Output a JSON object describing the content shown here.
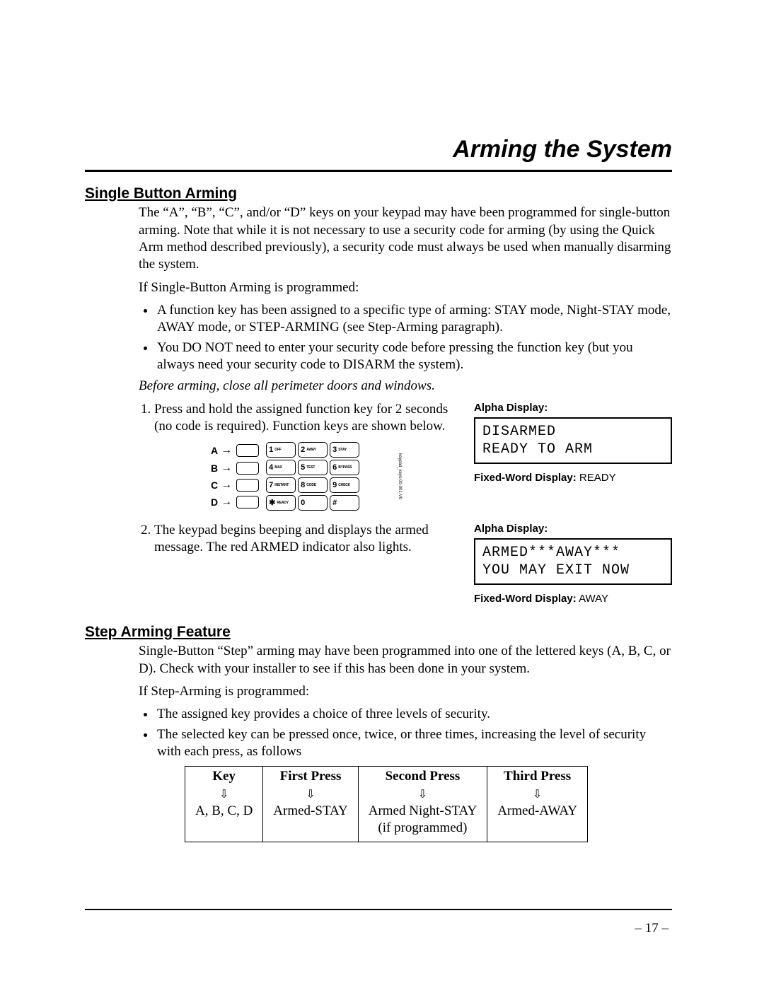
{
  "title": "Arming the System",
  "page_number": "– 17 –",
  "sections": {
    "single_button": {
      "heading": "Single Button Arming",
      "p1": "The “A”, “B”, “C”, and/or “D” keys on your keypad may have been programmed for single-button arming. Note that while it is not necessary to use a security code for arming (by using the Quick Arm method described previously), a security code must always be used when manually disarming the system.",
      "p2": "If Single-Button Arming is programmed:",
      "bullets": [
        "A function key has been assigned to a specific type of arming: STAY mode, Night-STAY mode, AWAY mode, or STEP-ARMING (see Step-Arming paragraph).",
        "You DO NOT need to enter your security code before pressing the function key (but you always need your security code to DISARM the system)."
      ],
      "preface": "Before arming, close all perimeter doors and windows.",
      "step1": "Press and hold the assigned function key for 2 seconds (no code is required). Function keys are shown below.",
      "step2": "The keypad begins beeping and displays the armed message. The red ARMED indicator also lights."
    },
    "step_arming": {
      "heading": "Step Arming Feature",
      "p1": "Single-Button “Step” arming may have been programmed into one of the lettered keys (A, B, C, or D). Check with your installer to see if this has been done in your system.",
      "p2": "If Step-Arming is programmed:",
      "bullets": [
        "The assigned key provides a choice of three levels of security.",
        "The selected key can be pressed once, twice, or three times, increasing the level of security with each press, as follows"
      ]
    }
  },
  "displays": {
    "alpha_label": "Alpha Display:",
    "fixed_label": "Fixed-Word Display:",
    "d1_line1": "DISARMED",
    "d1_line2": "READY TO ARM",
    "d1_fixed": "READY",
    "d2_line1": "ARMED***AWAY***",
    "d2_line2": "YOU MAY EXIT NOW",
    "d2_fixed": "AWAY"
  },
  "keypad": {
    "rows": [
      "A",
      "B",
      "C",
      "D"
    ],
    "keys": [
      {
        "d": "1",
        "s": "OFF"
      },
      {
        "d": "2",
        "s": "AWAY"
      },
      {
        "d": "3",
        "s": "STAY"
      },
      {
        "d": "4",
        "s": "MAX"
      },
      {
        "d": "5",
        "s": "TEST"
      },
      {
        "d": "6",
        "s": "BYPASS"
      },
      {
        "d": "7",
        "s": "INSTANT"
      },
      {
        "d": "8",
        "s": "CODE"
      },
      {
        "d": "9",
        "s": "CHECK"
      },
      {
        "d": "✱",
        "s": "READY"
      },
      {
        "d": "0",
        "s": ""
      },
      {
        "d": "#",
        "s": ""
      }
    ],
    "side_text": "keypad_keys-00-001-V0"
  },
  "table": {
    "headers": [
      "Key",
      "First Press",
      "Second Press",
      "Third Press"
    ],
    "row": {
      "key": "A, B, C, D",
      "first": "Armed-STAY",
      "second": "Armed Night-STAY",
      "second_note": "(if programmed)",
      "third": "Armed-AWAY"
    },
    "arrow": "⇩"
  }
}
